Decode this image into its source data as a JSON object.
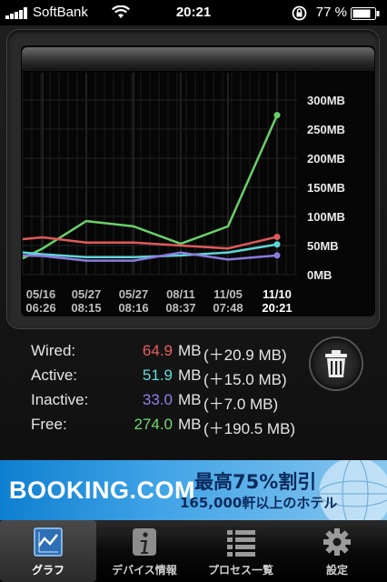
{
  "status_bar": {
    "carrier": "SoftBank",
    "time": "20:21",
    "battery_percent": "77 %"
  },
  "chart_data": {
    "type": "line",
    "x_labels_top": [
      "05/16",
      "05/27",
      "05/27",
      "08/11",
      "11/05",
      "11/10"
    ],
    "x_labels_bottom": [
      "06:26",
      "08:15",
      "08:16",
      "08:37",
      "07:48",
      "20:21"
    ],
    "y_tick_labels": [
      "300MB",
      "250MB",
      "200MB",
      "150MB",
      "100MB",
      "50MB",
      "0MB"
    ],
    "y_ticks": [
      300,
      250,
      200,
      150,
      100,
      50,
      0
    ],
    "ylim": [
      0,
      300
    ],
    "series": [
      {
        "name": "Free",
        "color": "#6ad16a",
        "values": [
          28,
          45,
          92,
          83,
          53,
          83,
          274
        ]
      },
      {
        "name": "Wired",
        "color": "#e05a5a",
        "values": [
          61,
          64,
          55,
          55,
          50,
          45,
          64.9
        ]
      },
      {
        "name": "Active",
        "color": "#5fd6d6",
        "values": [
          38,
          35,
          30,
          30,
          33,
          38,
          51.9
        ]
      },
      {
        "name": "Inactive",
        "color": "#8c7be0",
        "values": [
          33,
          32,
          24,
          24,
          38,
          26,
          33.0
        ]
      }
    ],
    "grid": true
  },
  "stats": [
    {
      "label": "Wired:",
      "value": "64.9",
      "unit": "MB",
      "delta": "(＋20.9 MB)",
      "color": "#e86060"
    },
    {
      "label": "Active:",
      "value": "51.9",
      "unit": "MB",
      "delta": "(＋15.0 MB)",
      "color": "#66d9d9"
    },
    {
      "label": "Inactive:",
      "value": "33.0",
      "unit": "MB",
      "delta": "(＋7.0 MB)",
      "color": "#8f80ea"
    },
    {
      "label": "Free:",
      "value": "274.0",
      "unit": "MB",
      "delta": "(＋190.5 MB)",
      "color": "#74d874"
    }
  ],
  "ad": {
    "brand": "BOOKING.COM",
    "line1": "最高75%割引",
    "line2": "165,000軒以上のホテル"
  },
  "tabs": [
    {
      "label": "グラフ",
      "icon": "graph-icon",
      "active": true
    },
    {
      "label": "デバイス情報",
      "icon": "info-icon",
      "active": false
    },
    {
      "label": "プロセス一覧",
      "icon": "list-icon",
      "active": false
    },
    {
      "label": "設定",
      "icon": "gear-icon",
      "active": false
    }
  ]
}
